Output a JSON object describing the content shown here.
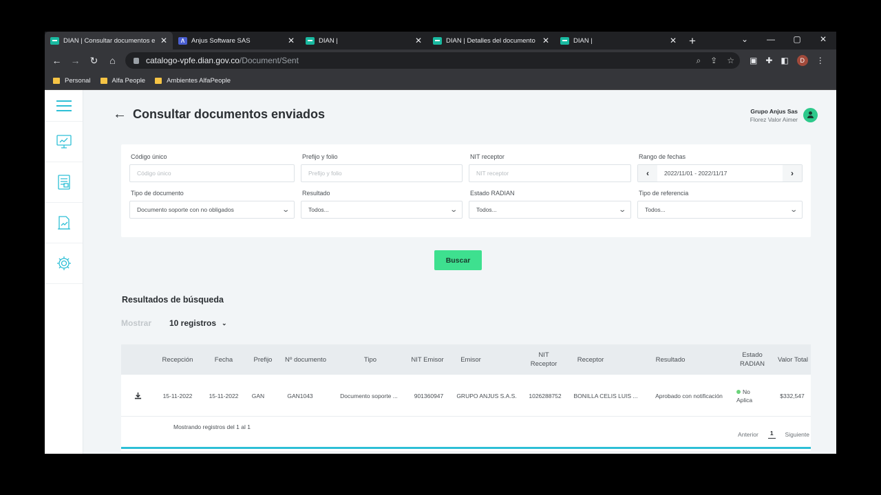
{
  "browser": {
    "tabs": [
      {
        "title": "DIAN | Consultar documentos e",
        "icon": "dian-icon",
        "active": true
      },
      {
        "title": "Anjus Software SAS",
        "icon": "anjus-icon",
        "active": false
      },
      {
        "title": "DIAN |",
        "icon": "dian-icon",
        "active": false
      },
      {
        "title": "DIAN | Detalles del documento",
        "icon": "dian-icon",
        "active": false
      },
      {
        "title": "DIAN |",
        "icon": "dian-icon",
        "active": false
      }
    ],
    "new_tab": "+",
    "url_host": "catalogo-vpfe.dian.gov.co",
    "url_path": "/Document/Sent",
    "profile_initial": "D",
    "bookmarks": [
      "Personal",
      "Alfa People",
      "Ambientes AlfaPeople"
    ]
  },
  "header": {
    "title": "Consultar documentos enviados",
    "company": "Grupo Anjus Sas",
    "user": "Florez Valor Aimer"
  },
  "filters": {
    "codigo_label": "Código único",
    "codigo_placeholder": "Código único",
    "prefijo_label": "Prefijo y folio",
    "prefijo_placeholder": "Prefijo y folio",
    "nit_label": "NIT receptor",
    "nit_placeholder": "NIT receptor",
    "rango_label": "Rango de fechas",
    "rango_value": "2022/11/01 - 2022/11/17",
    "tipo_doc_label": "Tipo de documento",
    "tipo_doc_value": "Documento soporte con no obligados",
    "resultado_label": "Resultado",
    "resultado_value": "Todos...",
    "estado_label": "Estado RADIAN",
    "estado_value": "Todos...",
    "tipo_ref_label": "Tipo de referencia",
    "tipo_ref_value": "Todos..."
  },
  "search_button": "Buscar",
  "results": {
    "title": "Resultados de búsqueda",
    "show_label": "Mostrar",
    "show_value": "10 registros",
    "columns": [
      "Recepción",
      "Fecha",
      "Prefijo",
      "Nº documento",
      "Tipo",
      "NIT Emisor",
      "Emisor",
      "NIT Receptor",
      "Receptor",
      "Resultado",
      "Estado RADIAN",
      "Valor Total"
    ],
    "rows": [
      {
        "recepcion": "15-11-2022",
        "fecha": "15-11-2022",
        "prefijo": "GAN",
        "numero": "GAN1043",
        "tipo": "Documento soporte ...",
        "nit_emisor": "901360947",
        "emisor": "GRUPO ANJUS S.A.S.",
        "nit_receptor": "1026288752",
        "receptor": "BONILLA CELIS LUIS ...",
        "resultado": "Aprobado con notificación",
        "estado_radian": "No Aplica",
        "valor_total": "$332,547"
      }
    ],
    "showing_text": "Mostrando registros del 1 al 1",
    "pager_prev": "Anterior",
    "pager_current": "1",
    "pager_next": "Siguiente"
  },
  "colors": {
    "accent_green": "#3ee08f",
    "accent_teal": "#2dbfd6",
    "status_green": "#6bd37a"
  }
}
